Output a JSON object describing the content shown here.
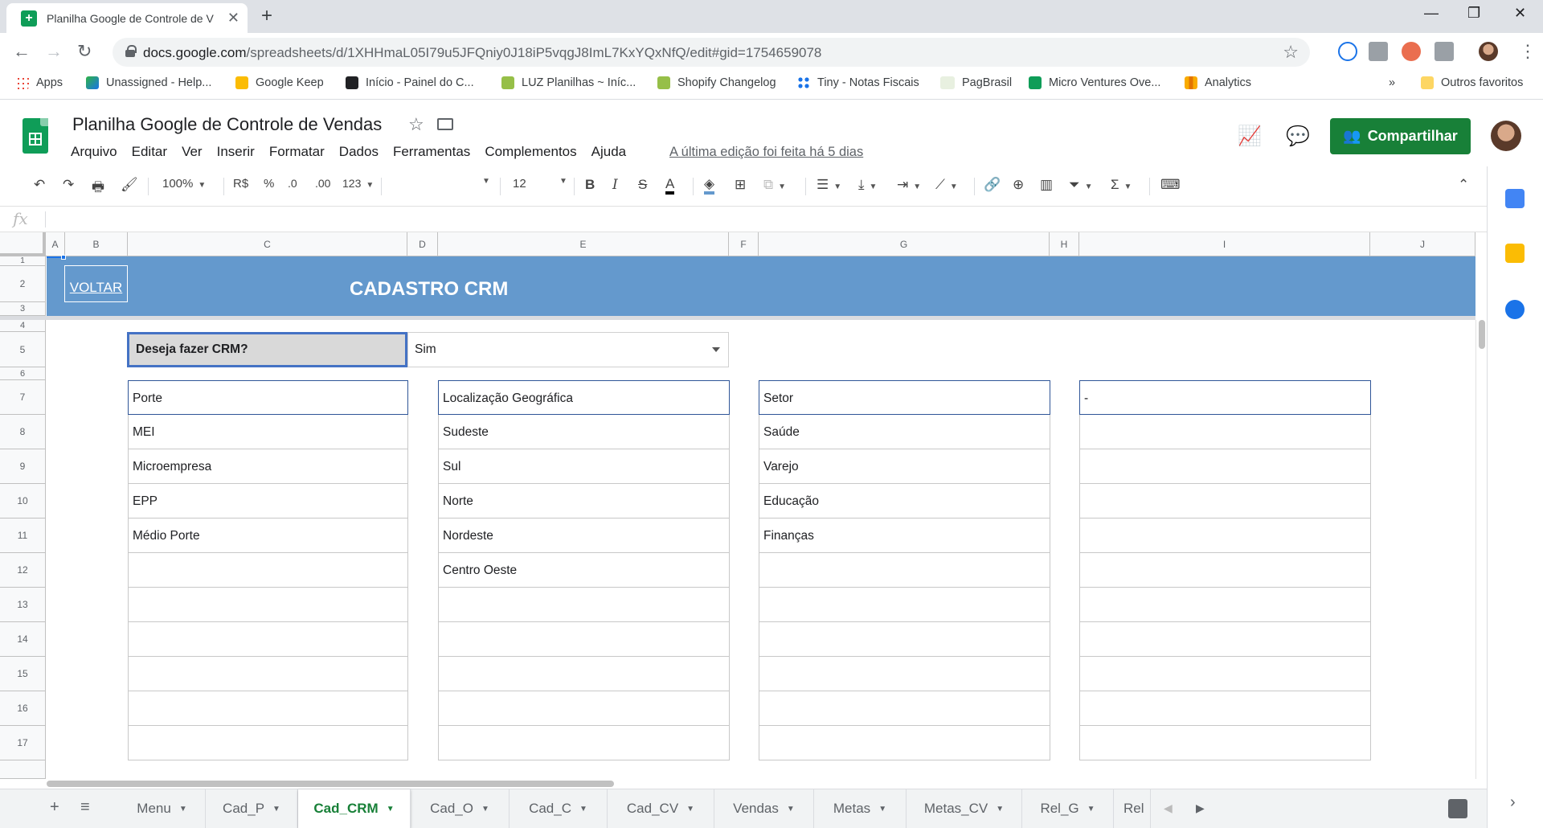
{
  "browser": {
    "tab_title": "Planilha Google de Controle de V",
    "url_host": "docs.google.com",
    "url_path": "/spreadsheets/d/1XHHmaL05I79u5JFQniy0J18iP5vqgJ8ImL7KxYQxNfQ/edit#gid=1754659078",
    "bookmarks": [
      "Apps",
      "Unassigned - Help...",
      "Google Keep",
      "Início - Painel do C...",
      "LUZ Planilhas ~ Iníc...",
      "Shopify Changelog",
      "Tiny - Notas Fiscais",
      "PagBrasil",
      "Micro Ventures Ove...",
      "Analytics"
    ],
    "bookmarks_more": "»",
    "other_bookmarks": "Outros favoritos"
  },
  "doc": {
    "title": "Planilha Google de Controle de Vendas",
    "menu": [
      "Arquivo",
      "Editar",
      "Ver",
      "Inserir",
      "Formatar",
      "Dados",
      "Ferramentas",
      "Complementos",
      "Ajuda"
    ],
    "last_edit": "A última edição foi feita há 5 dias",
    "share_label": "Compartilhar"
  },
  "toolbar": {
    "zoom": "100%",
    "currency": "R$",
    "percent": "%",
    "dec_less": ".0",
    "dec_more": ".00",
    "format_more": "123",
    "font_size": "12"
  },
  "formula_bar": {
    "fx": "fx"
  },
  "grid": {
    "columns": [
      "A",
      "B",
      "C",
      "D",
      "E",
      "F",
      "G",
      "H",
      "I",
      "J"
    ],
    "rows": [
      "1",
      "2",
      "3",
      "4",
      "5",
      "6",
      "7",
      "8",
      "9",
      "10",
      "11",
      "12",
      "13",
      "14",
      "15",
      "16",
      "17"
    ],
    "banner_link": "VOLTAR",
    "banner_title": "CADASTRO CRM",
    "question_label": "Deseja fazer CRM?",
    "question_value": "Sim",
    "lists": [
      {
        "header": "Porte",
        "items": [
          "MEI",
          "Microempresa",
          "EPP",
          "Médio Porte",
          "",
          "",
          "",
          "",
          "",
          ""
        ]
      },
      {
        "header": "Localização Geográfica",
        "items": [
          "Sudeste",
          "Sul",
          "Norte",
          "Nordeste",
          "Centro Oeste",
          "",
          "",
          "",
          "",
          ""
        ]
      },
      {
        "header": "Setor",
        "items": [
          "Saúde",
          "Varejo",
          "Educação",
          "Finanças",
          "",
          "",
          "",
          "",
          "",
          ""
        ]
      },
      {
        "header": "-",
        "items": [
          "",
          "",
          "",
          "",
          "",
          "",
          "",
          "",
          "",
          ""
        ]
      }
    ]
  },
  "sheet_tabs": [
    "Menu",
    "Cad_P",
    "Cad_CRM",
    "Cad_O",
    "Cad_C",
    "Cad_CV",
    "Vendas",
    "Metas",
    "Metas_CV",
    "Rel_G",
    "Rel"
  ],
  "active_sheet": "Cad_CRM",
  "colors": {
    "banner": "#6499cd",
    "share": "#188038",
    "header_border": "#2f5597"
  }
}
